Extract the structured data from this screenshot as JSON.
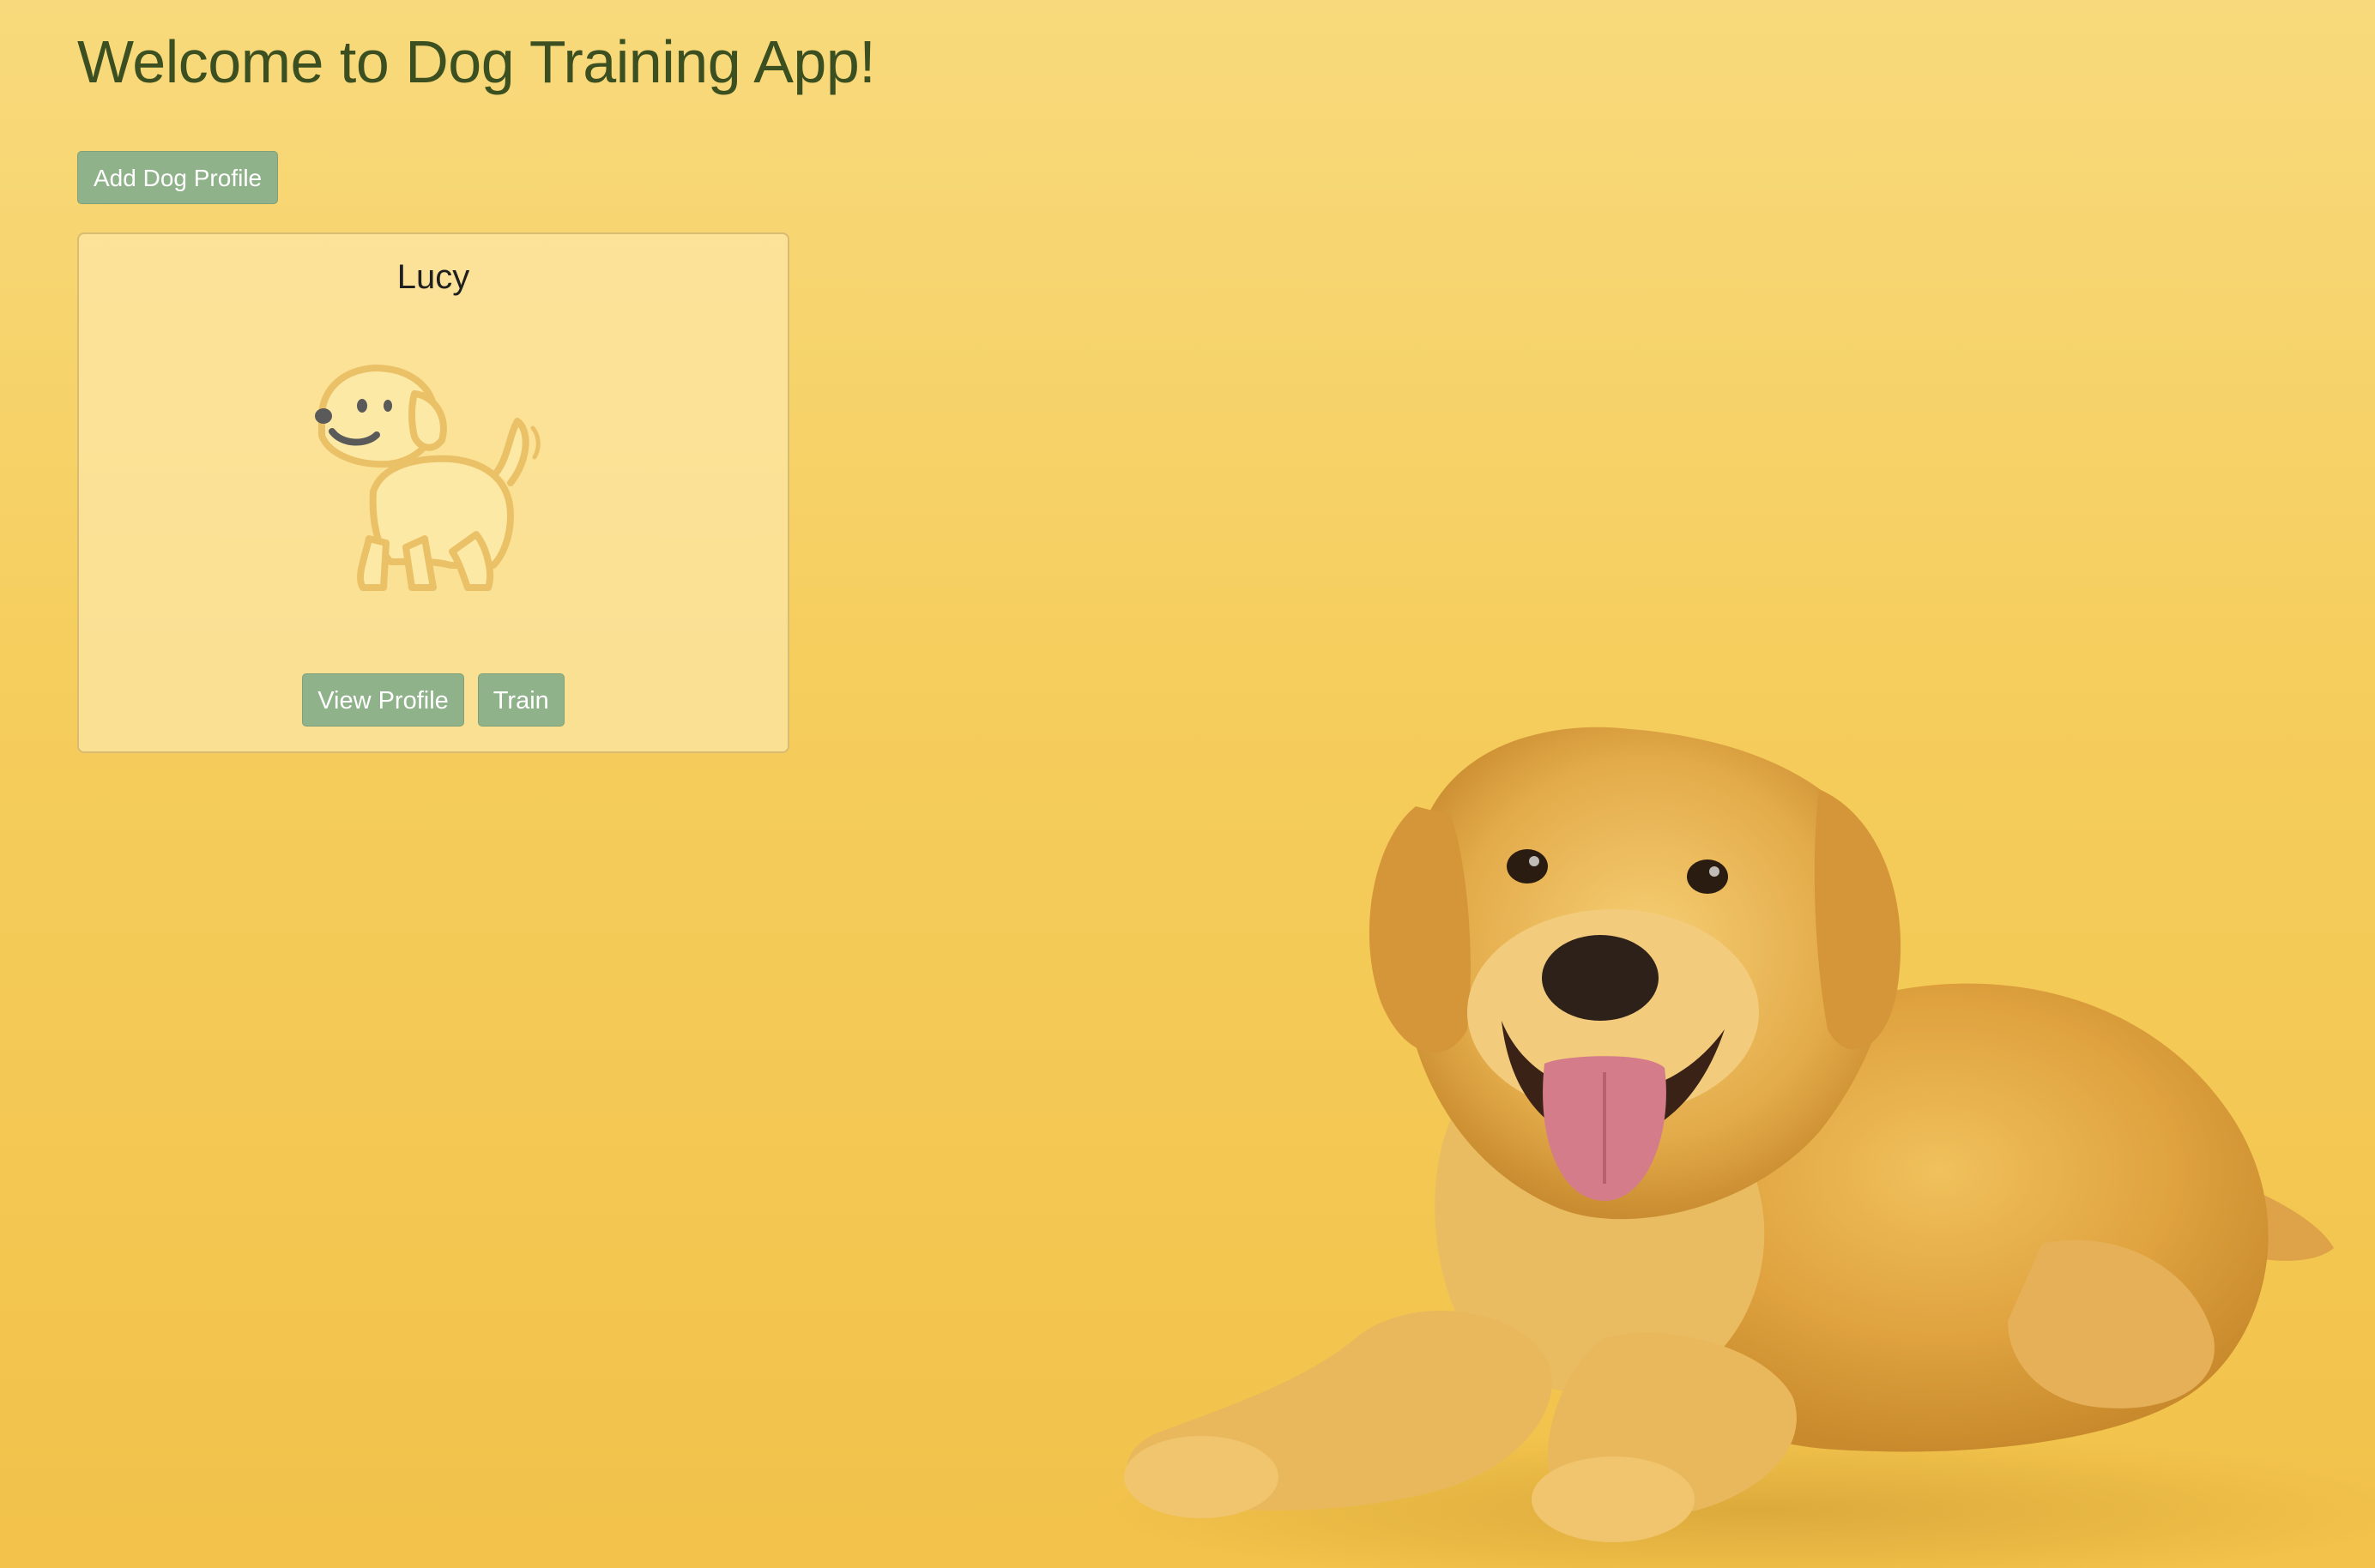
{
  "app": {
    "title": "Welcome to Dog Training App!"
  },
  "toolbar": {
    "add_dog_label": "Add Dog Profile"
  },
  "dogs": [
    {
      "name": "Lucy",
      "avatar_icon": "dog-icon",
      "view_profile_label": "View Profile",
      "train_label": "Train"
    }
  ],
  "background": {
    "subject": "golden-retriever-photo"
  },
  "colors": {
    "background": "#f5cd5c",
    "title": "#3b4f21",
    "button": "#8fb28a",
    "button_text": "#ffffff",
    "card_background": "#fce8a8",
    "card_border": "#d9bb72"
  }
}
